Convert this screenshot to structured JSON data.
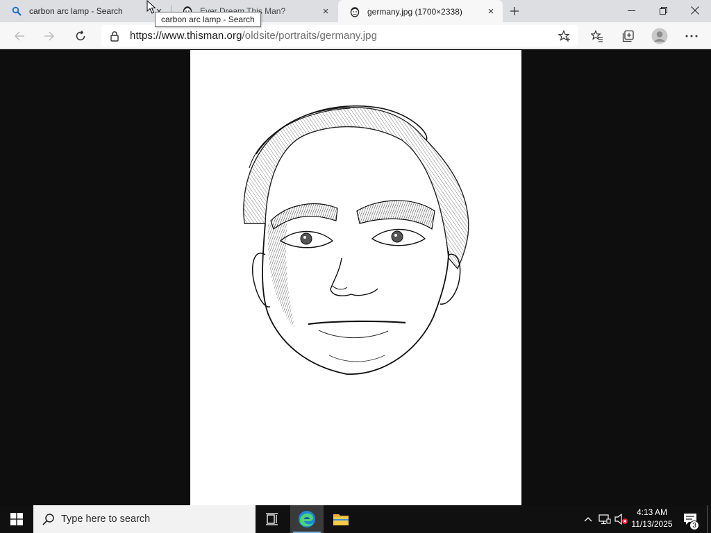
{
  "browser": {
    "tabs": [
      {
        "title": "carbon arc lamp - Search",
        "favicon": "search-icon",
        "active": false
      },
      {
        "title": "Ever Dream This Man?",
        "favicon": "thisman-icon",
        "active": false
      },
      {
        "title": "germany.jpg (1700×2338)",
        "favicon": "thisman-icon",
        "active": true
      }
    ],
    "tooltip": "carbon arc lamp - Search",
    "address": {
      "host": "https://www.thisman.org",
      "path": "/oldsite/portraits/germany.jpg"
    }
  },
  "taskbar": {
    "search_placeholder": "Type here to search",
    "time": "4:13 AM",
    "date": "11/13/2025",
    "notification_count": "3"
  },
  "colors": {
    "active_tab": "#f7f7f7",
    "tab_strip": "#dcdee1",
    "viewer_bg": "#0e0e0e",
    "taskbar": "#101010",
    "accent": "#0078d4"
  }
}
